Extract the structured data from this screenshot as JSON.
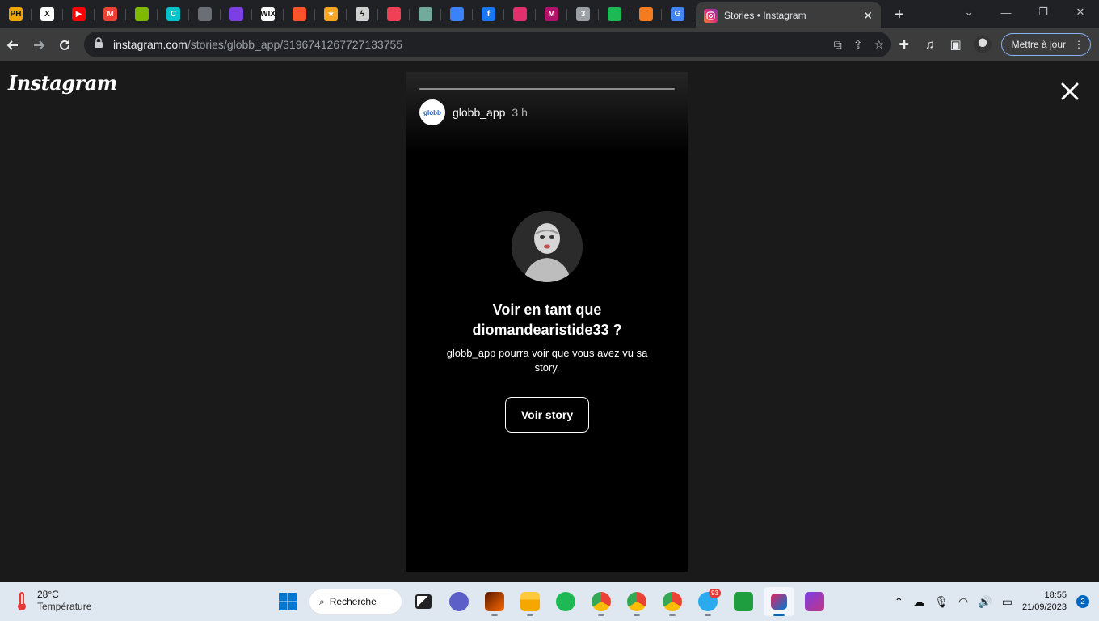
{
  "browser": {
    "pinned_tabs": [
      {
        "icon": "producthunt-icon",
        "text": "PH",
        "color": "#f0a500"
      },
      {
        "icon": "x-icon",
        "text": "X",
        "color": "#ffffff"
      },
      {
        "icon": "youtube-icon",
        "text": "▶",
        "color": "#ff0000"
      },
      {
        "icon": "gmail-icon",
        "text": "M",
        "color": "#ea4335"
      },
      {
        "icon": "microsoft-icon",
        "text": "",
        "color": "#7fba00"
      },
      {
        "icon": "canva-icon",
        "text": "C",
        "color": "#00c4cc"
      },
      {
        "icon": "globe-icon",
        "text": "",
        "color": "#6b6f75"
      },
      {
        "icon": "app-purple-icon",
        "text": "",
        "color": "#7b3fe4"
      },
      {
        "icon": "wix-icon",
        "text": "WIX",
        "color": "#ffffff"
      },
      {
        "icon": "brave-icon",
        "text": "",
        "color": "#fb542b"
      },
      {
        "icon": "star-icon",
        "text": "★",
        "color": "#f5a623"
      },
      {
        "icon": "lightning-icon",
        "text": "ϟ",
        "color": "#d0d0d0"
      },
      {
        "icon": "pocket-icon",
        "text": "",
        "color": "#ef4056"
      },
      {
        "icon": "chatgpt-icon",
        "text": "",
        "color": "#74aa9c"
      },
      {
        "icon": "shield-icon",
        "text": "",
        "color": "#3b82f6"
      },
      {
        "icon": "facebook-icon",
        "text": "f",
        "color": "#1877f2"
      },
      {
        "icon": "instagram-icon",
        "text": "",
        "color": "#e1306c"
      },
      {
        "icon": "m-logo-icon",
        "text": "M",
        "color": "#b1126b"
      },
      {
        "icon": "app-3-icon",
        "text": "3",
        "color": "#9aa0a6"
      },
      {
        "icon": "ring-icon",
        "text": "",
        "color": "#1db954"
      },
      {
        "icon": "sun-icon",
        "text": "",
        "color": "#f47b20"
      },
      {
        "icon": "google-icon",
        "text": "G",
        "color": "#4285f4"
      }
    ],
    "active_tab": {
      "title": "Stories • Instagram"
    },
    "url_host": "instagram.com",
    "url_path": "/stories/globb_app/3196741267727133755",
    "update_button": "Mettre à jour"
  },
  "page": {
    "logo": "Instagram",
    "story": {
      "username": "globb_app",
      "avatar_text": "globb",
      "time": "3 h",
      "prompt_line1": "Voir en tant que",
      "prompt_line2": "diomandearistide33 ?",
      "subtitle": "globb_app pourra voir que vous avez vu sa story.",
      "button": "Voir story"
    }
  },
  "taskbar": {
    "temperature": "28°C",
    "weather_label": "Température",
    "search_label": "Recherche",
    "telegram_badge": "93",
    "time": "18:55",
    "date": "21/09/2023",
    "notifications": "2"
  }
}
